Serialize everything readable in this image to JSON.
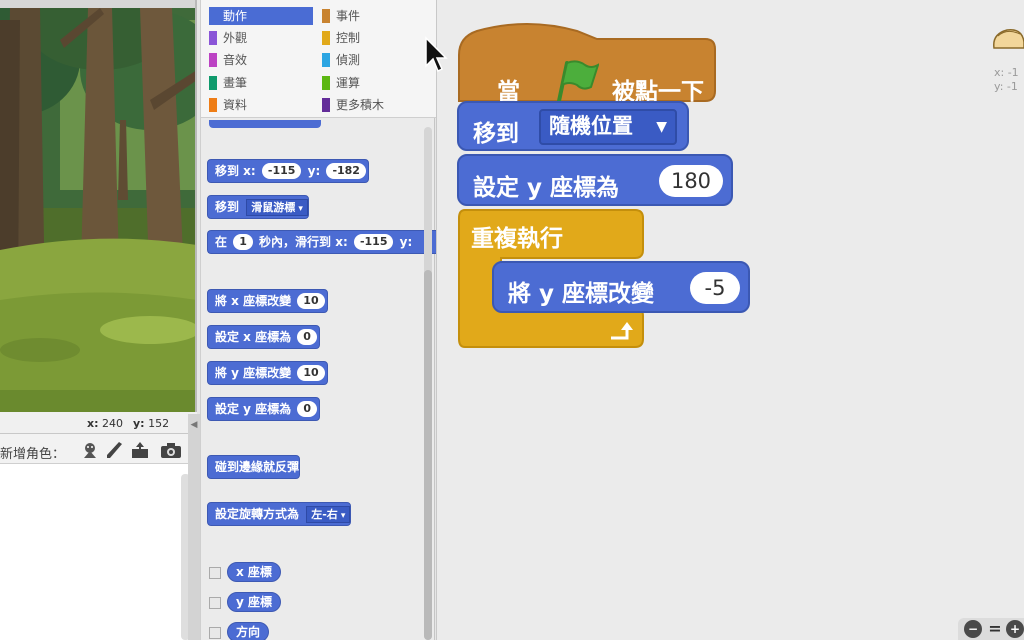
{
  "stage": {
    "coords": {
      "x_label": "x:",
      "x_value": "240",
      "y_label": "y:",
      "y_value": "152"
    }
  },
  "sprites": {
    "new_sprite_label": "新增角色：",
    "icons": [
      "choose-sprite-icon",
      "paint-icon",
      "upload-icon",
      "camera-icon"
    ]
  },
  "palette": {
    "categories": [
      {
        "label": "動作",
        "color": "#4a6cd4",
        "selected": true
      },
      {
        "label": "事件",
        "color": "#c88330"
      },
      {
        "label": "外觀",
        "color": "#8a55d7"
      },
      {
        "label": "控制",
        "color": "#e1a91a"
      },
      {
        "label": "音效",
        "color": "#bb42c3"
      },
      {
        "label": "偵測",
        "color": "#2ca5e2"
      },
      {
        "label": "畫筆",
        "color": "#0e9a6c"
      },
      {
        "label": "運算",
        "color": "#5cb712"
      },
      {
        "label": "資料",
        "color": "#ee7d16"
      },
      {
        "label": "更多積木",
        "color": "#632d99"
      }
    ],
    "blocks": {
      "goto_xy": {
        "a": "移到 x:",
        "x": "-115",
        "b": "y:",
        "y": "-182"
      },
      "goto_target": {
        "a": "移到",
        "dd": "滑鼠游標"
      },
      "glide": {
        "a": "在",
        "secs": "1",
        "b": "秒內，滑行到 x:",
        "x": "-115",
        "c": "y:"
      },
      "change_x": {
        "a": "將 x 座標改變",
        "v": "10"
      },
      "set_x": {
        "a": "設定 x 座標為",
        "v": "0"
      },
      "change_y": {
        "a": "將 y 座標改變",
        "v": "10"
      },
      "set_y": {
        "a": "設定 y 座標為",
        "v": "0"
      },
      "bounce": {
        "a": "碰到邊緣就反彈"
      },
      "rotation": {
        "a": "設定旋轉方式為",
        "dd": "左-右"
      },
      "reporters": [
        "x 座標",
        "y 座標",
        "方向"
      ]
    }
  },
  "script": {
    "hat": {
      "a": "當",
      "b": "被點一下"
    },
    "move": {
      "label": "移到",
      "dropdown": "隨機位置"
    },
    "set_y": {
      "label": "設定 y 座標為",
      "value": "180"
    },
    "forever": {
      "label": "重複執行"
    },
    "change_y": {
      "label": "將 y 座標改變",
      "value": "-5"
    }
  },
  "sprite_info": {
    "x": "x: -1",
    "y": "y: -1"
  },
  "zoom": {
    "out": "−",
    "reset": "=",
    "in": "+"
  },
  "colors": {
    "motion": "#4c6cd3",
    "events": "#c88330",
    "control": "#e1a91a",
    "flag": "#4cae3c"
  }
}
